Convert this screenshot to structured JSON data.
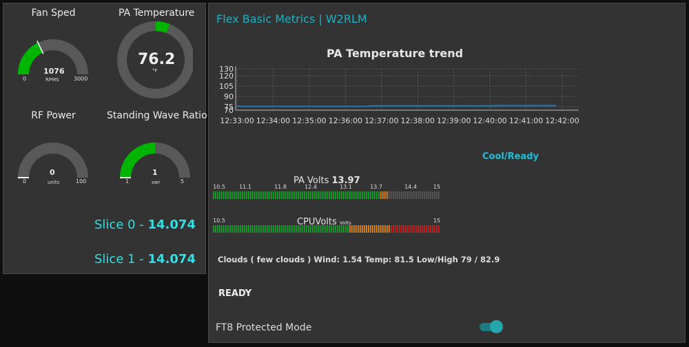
{
  "gauges": {
    "fan": {
      "title": "Fan Sped",
      "value": "1076",
      "units": "RPMS",
      "min": "0",
      "max": "3000",
      "fraction": 0.359
    },
    "pa_temp": {
      "title": "PA Temperature",
      "value": "76.2",
      "units": "°F",
      "fraction": 0.06
    },
    "rf_power": {
      "title": "RF Power",
      "value": "0",
      "units": "units",
      "min": "0",
      "max": "100",
      "fraction": 0
    },
    "swr": {
      "title": "Standing Wave Ratio",
      "value": "1",
      "units": "swr",
      "min": "1",
      "max": "5",
      "fraction": 0.5
    }
  },
  "slices": [
    {
      "label": "Slice 0 - ",
      "value": "14.074"
    },
    {
      "label": "Slice 1 - ",
      "value": "14.074"
    }
  ],
  "dashboard_title": "Flex Basic Metrics | W2RLM",
  "chart_data": {
    "type": "line",
    "title": "PA Temperature trend",
    "y_ticks": [
      "130",
      "120",
      "105",
      "90",
      "75",
      "70"
    ],
    "x_ticks": [
      "12:33:00",
      "12:34:00",
      "12:35:00",
      "12:36:00",
      "12:37:00",
      "12:38:00",
      "12:39:00",
      "12:40:00",
      "12:41:00",
      "12:42:00"
    ],
    "series": [
      {
        "x": [
          "12:33:00",
          "12:36:30",
          "12:36:45",
          "12:40:00",
          "12:40:15",
          "12:41:50"
        ],
        "y": [
          75.5,
          75.5,
          76.2,
          76.2,
          76.6,
          76.6
        ]
      }
    ],
    "color": "#1f77b4"
  },
  "status": "Cool/Ready",
  "pa_volts": {
    "label": "PA Volts",
    "value": "13.97",
    "ticks": [
      "10.5",
      "11.1",
      "11.8",
      "12.4",
      "13.1",
      "13.7",
      "14.4",
      "15"
    ]
  },
  "cpu_volts": {
    "label": "CPUVolts",
    "units": "Volts",
    "ticks": [
      "10.5",
      "15"
    ]
  },
  "weather": "Clouds ( few clouds ) Wind: 1.54 Temp: 81.5 Low/High 79 / 82.9",
  "ready": "READY",
  "toggle": {
    "label": "FT8 Protected Mode",
    "on": true
  },
  "colors": {
    "gauge_fill": "#00b500",
    "gauge_track": "#595959",
    "slice": "#33dfe2",
    "title": "#1eb2c4",
    "meter_green": "#12a82a",
    "meter_orange": "#ee8e19",
    "meter_red": "#d21e1e",
    "meter_off": "#5a5a5a"
  }
}
